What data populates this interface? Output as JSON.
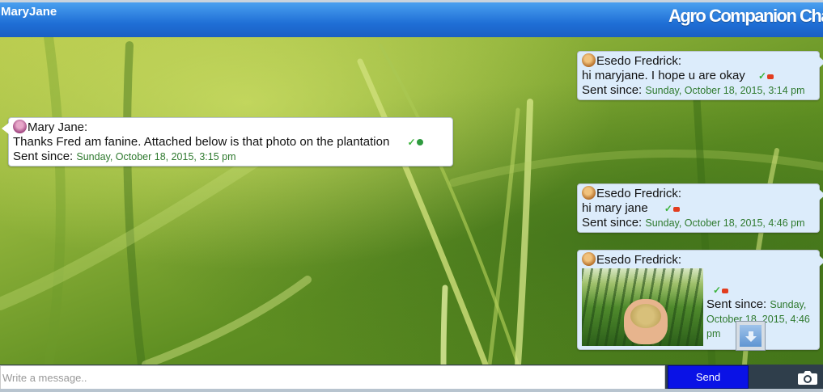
{
  "header": {
    "user_name": "MaryJane",
    "app_title": "Agro Companion Cha"
  },
  "messages": [
    {
      "sender": "Esedo Fredrick:",
      "text": "hi maryjane. I hope u are okay",
      "sent_label": "Sent since:",
      "timestamp": "Sunday, October 18, 2015, 3:14 pm"
    },
    {
      "sender": "Mary Jane:",
      "text": "Thanks Fred am fanine. Attached below is that photo on the plantation",
      "sent_label": "Sent since:",
      "timestamp": "Sunday, October 18, 2015, 3:15 pm"
    },
    {
      "sender": "Esedo Fredrick:",
      "text": "hi mary jane",
      "sent_label": "Sent since:",
      "timestamp": "Sunday, October 18, 2015, 4:46 pm"
    },
    {
      "sender": "Esedo Fredrick:",
      "text": "",
      "sent_label": "Sent since:",
      "timestamp": "Sunday, October 18, 2015, 4:46 pm",
      "attachment_icon": "plantation-photo"
    }
  ],
  "composer": {
    "placeholder": "Write a message..",
    "send_label": "Send",
    "camera_icon": "camera-icon"
  },
  "colors": {
    "header": "#1f6fd6",
    "send_button": "#0a12e6",
    "timestamp": "#2f7a2f",
    "incoming_bubble": "#dcecfb"
  }
}
